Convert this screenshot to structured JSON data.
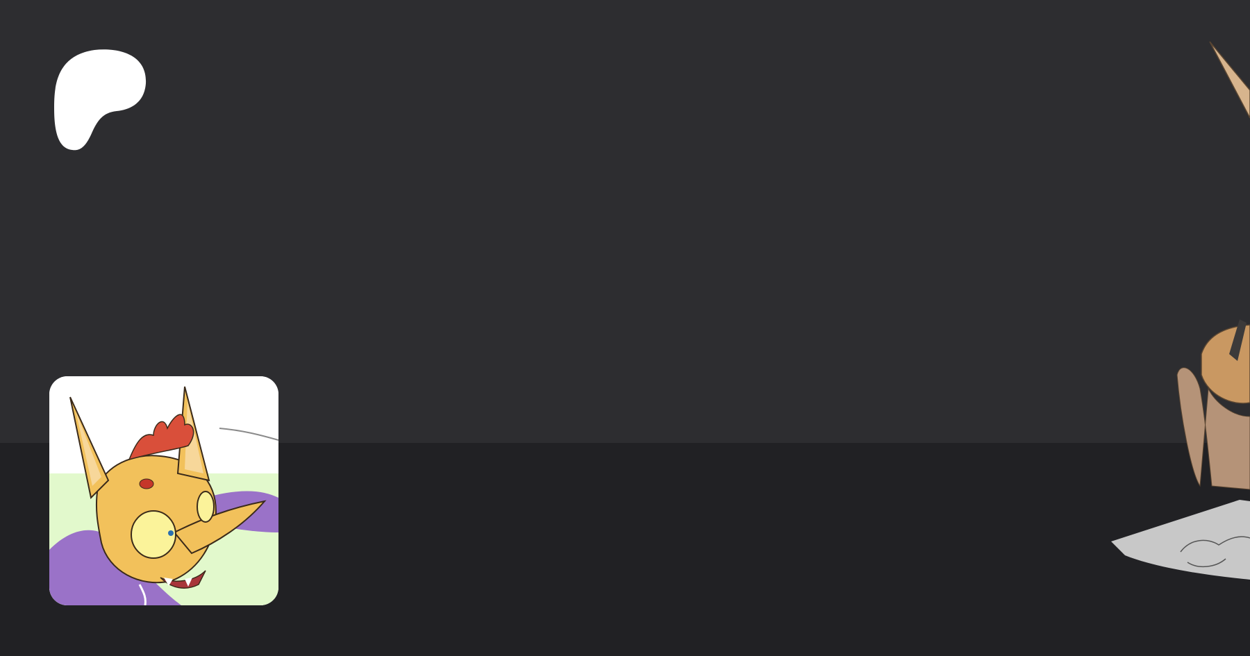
{
  "app": {
    "brand_icon": "patreon-logo-icon"
  },
  "colors": {
    "header_background": "#2d2d30",
    "lower_background": "#212124",
    "logo": "#ffffff",
    "avatar_border": "#ffffff"
  },
  "avatar": {
    "icon": "creator-avatar-fox-character"
  },
  "cover": {
    "icon": "cover-art-character-drawing"
  }
}
